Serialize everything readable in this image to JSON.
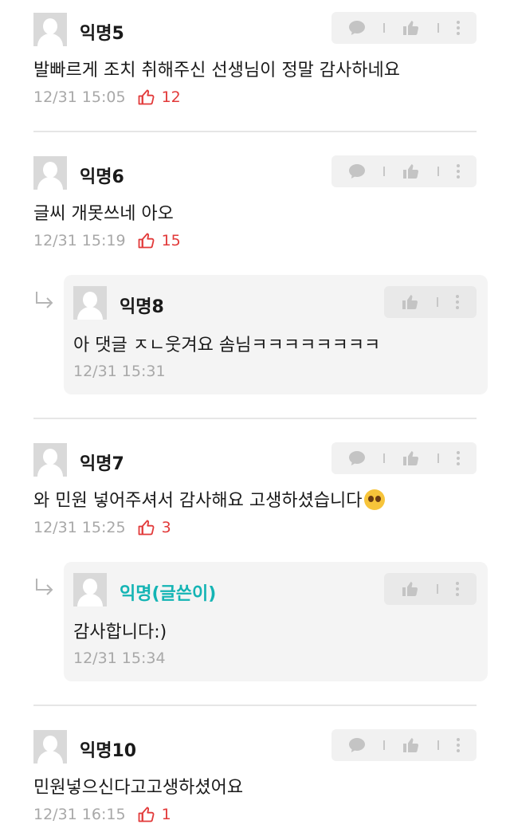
{
  "comments": [
    {
      "name": "익명5",
      "text": "발빠르게 조치 취해주신 선생님이 정말 감사하네요",
      "time": "12/31 15:05",
      "likes": "12"
    },
    {
      "name": "익명6",
      "text": "글씨 개못쓰네 아오",
      "time": "12/31 15:19",
      "likes": "15",
      "reply": {
        "name": "익명8",
        "text": "아 댓글 ㅈㄴ웃겨요 솜님ㅋㅋㅋㅋㅋㅋㅋㅋ",
        "time": "12/31 15:31"
      }
    },
    {
      "name": "익명7",
      "text": "와 민원 넣어주셔서 감사해요 고생하셨습니다",
      "emoji": "pleading-face-emoji",
      "time": "12/31 15:25",
      "likes": "3",
      "reply": {
        "name": "익명(글쓴이)",
        "text": "감사합니다:)",
        "time": "12/31 15:34"
      }
    },
    {
      "name": "익명10",
      "text": "민원넣으신다고고생하셨어요",
      "time": "12/31 16:15",
      "likes": "1"
    }
  ],
  "icons": {
    "comment": "speech-bubble-icon",
    "like": "thumbs-up-icon",
    "more": "vertical-dots-icon",
    "reply_marker": "reply-arrow-icon",
    "avatar": "default-avatar-icon"
  },
  "colors": {
    "like_count": "#e23a3a",
    "author_name": "#14b4b4",
    "meta_text": "#a8a8a8",
    "reply_bg": "#f4f4f4"
  }
}
